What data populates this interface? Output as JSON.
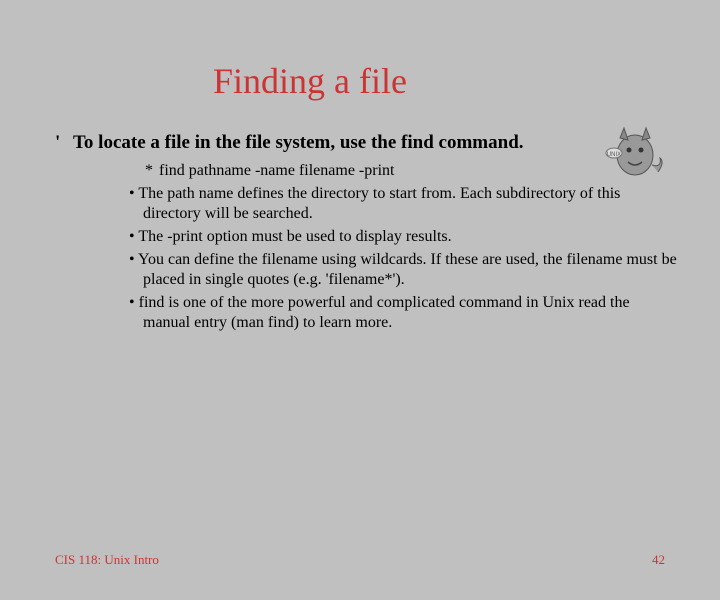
{
  "title": "Finding a file",
  "main_point": "To locate a file in the file system, use the find command.",
  "syntax": "find pathname -name filename -print",
  "bullets": [
    "The path name defines the directory to start from. Each subdirectory of this directory will be searched.",
    "The -print option must be used to display results.",
    "You can define the filename using wildcards. If these are used, the filename must be placed in single quotes (e.g. 'filename*').",
    "find is one of the more powerful and complicated command in Unix read the manual entry (man find) to learn more."
  ],
  "footer_left": "CIS 118: Unix Intro",
  "footer_right": "42"
}
